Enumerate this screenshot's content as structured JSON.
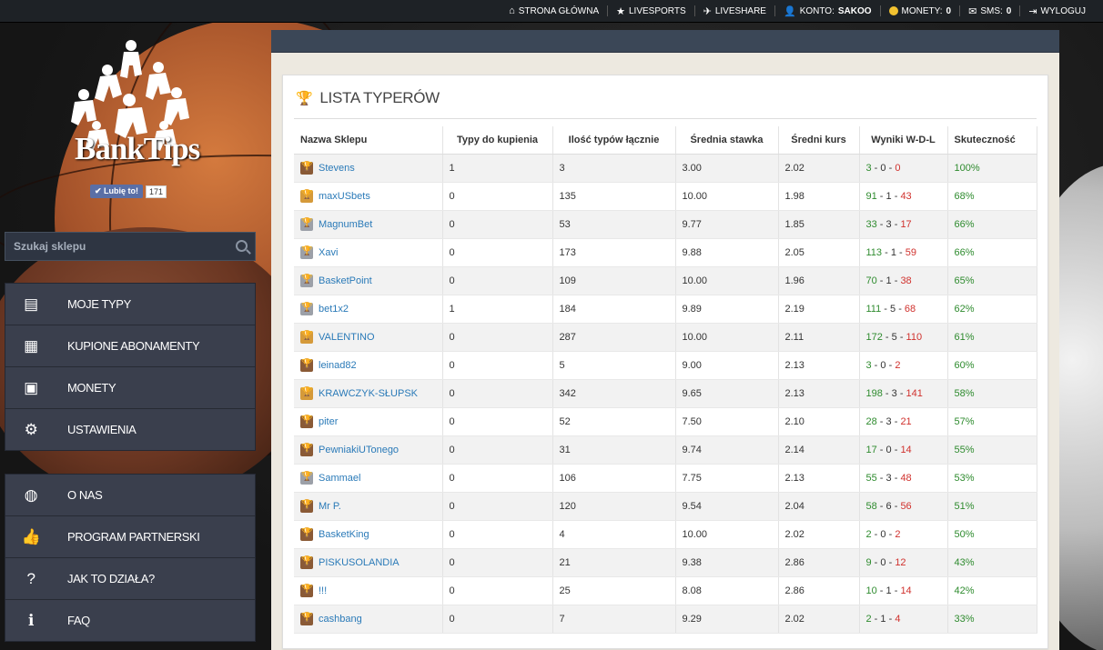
{
  "topnav": {
    "home": "STRONA GŁÓWNA",
    "livesports": "LIVESPORTS",
    "liveshare": "LIVESHARE",
    "account_label": "KONTO:",
    "account_name": "SAKOO",
    "coins_label": "MONETY:",
    "coins_value": "0",
    "sms_label": "SMS:",
    "sms_value": "0",
    "logout": "WYLOGUJ"
  },
  "logo": {
    "text": "BankTips"
  },
  "like": {
    "label": "Lubię to!",
    "count": "171"
  },
  "search": {
    "placeholder": "Szukaj sklepu",
    "value": ""
  },
  "menu1": [
    {
      "label": "MOJE TYPY",
      "icon": "book-icon"
    },
    {
      "label": "KUPIONE ABONAMENTY",
      "icon": "calendar-icon"
    },
    {
      "label": "MONETY",
      "icon": "money-icon"
    },
    {
      "label": "USTAWIENIA",
      "icon": "gear-icon"
    }
  ],
  "menu2": [
    {
      "label": "O NAS",
      "icon": "globe-icon"
    },
    {
      "label": "PROGRAM PARTNERSKI",
      "icon": "thumbs-up-icon"
    },
    {
      "label": "JAK TO DZIAŁA?",
      "icon": "question-icon"
    },
    {
      "label": "FAQ",
      "icon": "info-icon"
    }
  ],
  "main": {
    "title": "LISTA TYPERÓW",
    "columns": [
      "Nazwa Sklepu",
      "Typy do kupienia",
      "Ilość typów łącznie",
      "Średnia stawka",
      "Średni kurs",
      "Wyniki W-D-L",
      "Skuteczność"
    ],
    "rows": [
      {
        "rank": "brown",
        "name": "Stevens",
        "to_buy": "1",
        "total": "3",
        "stake": "3.00",
        "odds": "2.02",
        "w": "3",
        "d": "0",
        "l": "0",
        "eff": "100%"
      },
      {
        "rank": "gold",
        "name": "maxUSbets",
        "to_buy": "0",
        "total": "135",
        "stake": "10.00",
        "odds": "1.98",
        "w": "91",
        "d": "1",
        "l": "43",
        "eff": "68%"
      },
      {
        "rank": "silver",
        "name": "MagnumBet",
        "to_buy": "0",
        "total": "53",
        "stake": "9.77",
        "odds": "1.85",
        "w": "33",
        "d": "3",
        "l": "17",
        "eff": "66%"
      },
      {
        "rank": "silver",
        "name": "Xavi",
        "to_buy": "0",
        "total": "173",
        "stake": "9.88",
        "odds": "2.05",
        "w": "113",
        "d": "1",
        "l": "59",
        "eff": "66%"
      },
      {
        "rank": "silver",
        "name": "BasketPoint",
        "to_buy": "0",
        "total": "109",
        "stake": "10.00",
        "odds": "1.96",
        "w": "70",
        "d": "1",
        "l": "38",
        "eff": "65%"
      },
      {
        "rank": "silver",
        "name": "bet1x2",
        "to_buy": "1",
        "total": "184",
        "stake": "9.89",
        "odds": "2.19",
        "w": "111",
        "d": "5",
        "l": "68",
        "eff": "62%"
      },
      {
        "rank": "gold",
        "name": "VALENTINO",
        "to_buy": "0",
        "total": "287",
        "stake": "10.00",
        "odds": "2.11",
        "w": "172",
        "d": "5",
        "l": "110",
        "eff": "61%"
      },
      {
        "rank": "brown",
        "name": "leinad82",
        "to_buy": "0",
        "total": "5",
        "stake": "9.00",
        "odds": "2.13",
        "w": "3",
        "d": "0",
        "l": "2",
        "eff": "60%"
      },
      {
        "rank": "gold",
        "name": "KRAWCZYK-SŁUPSK",
        "to_buy": "0",
        "total": "342",
        "stake": "9.65",
        "odds": "2.13",
        "w": "198",
        "d": "3",
        "l": "141",
        "eff": "58%"
      },
      {
        "rank": "brown",
        "name": "piter",
        "to_buy": "0",
        "total": "52",
        "stake": "7.50",
        "odds": "2.10",
        "w": "28",
        "d": "3",
        "l": "21",
        "eff": "57%"
      },
      {
        "rank": "brown",
        "name": "PewniakiUTonego",
        "to_buy": "0",
        "total": "31",
        "stake": "9.74",
        "odds": "2.14",
        "w": "17",
        "d": "0",
        "l": "14",
        "eff": "55%"
      },
      {
        "rank": "silver",
        "name": "Sammael",
        "to_buy": "0",
        "total": "106",
        "stake": "7.75",
        "odds": "2.13",
        "w": "55",
        "d": "3",
        "l": "48",
        "eff": "53%"
      },
      {
        "rank": "brown",
        "name": "Mr P.",
        "to_buy": "0",
        "total": "120",
        "stake": "9.54",
        "odds": "2.04",
        "w": "58",
        "d": "6",
        "l": "56",
        "eff": "51%"
      },
      {
        "rank": "brown",
        "name": "BasketKing",
        "to_buy": "0",
        "total": "4",
        "stake": "10.00",
        "odds": "2.02",
        "w": "2",
        "d": "0",
        "l": "2",
        "eff": "50%"
      },
      {
        "rank": "brown",
        "name": "PISKUSOLANDIA",
        "to_buy": "0",
        "total": "21",
        "stake": "9.38",
        "odds": "2.86",
        "w": "9",
        "d": "0",
        "l": "12",
        "eff": "43%"
      },
      {
        "rank": "brown",
        "name": "!!!",
        "to_buy": "0",
        "total": "25",
        "stake": "8.08",
        "odds": "2.86",
        "w": "10",
        "d": "1",
        "l": "14",
        "eff": "42%"
      },
      {
        "rank": "brown",
        "name": "cashbang",
        "to_buy": "0",
        "total": "7",
        "stake": "9.29",
        "odds": "2.02",
        "w": "2",
        "d": "1",
        "l": "4",
        "eff": "33%"
      }
    ]
  },
  "colors": {
    "win": "#2e8b2e",
    "loss": "#d0312d",
    "link": "#2a7ab8",
    "sidebar": "#3a3f4d"
  }
}
